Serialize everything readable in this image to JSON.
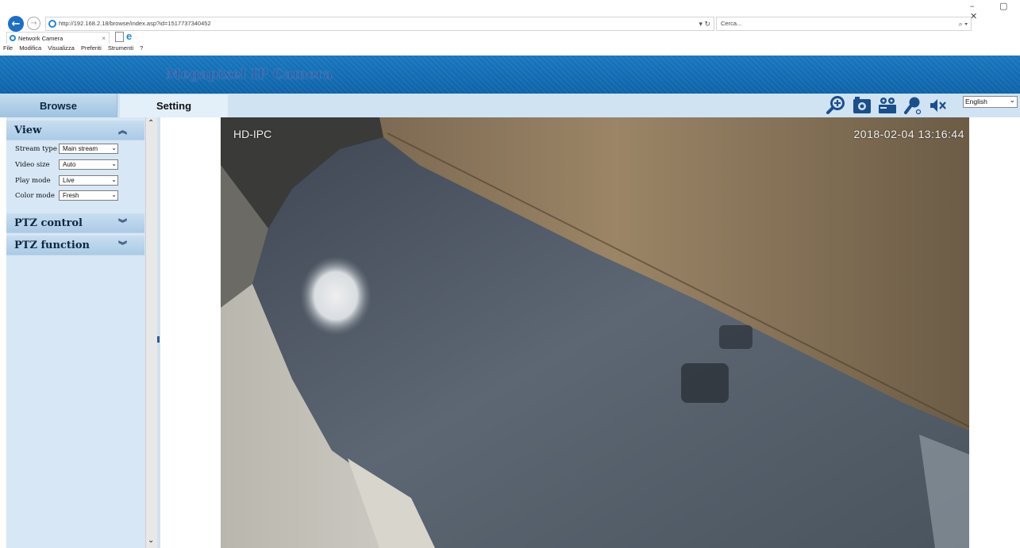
{
  "browser": {
    "url": "http://192.168.2.18/browse/index.asp?id=1517737340452",
    "url_controls": "▾ ↻",
    "search_placeholder": "Cerca...",
    "search_controls": "⌕ ▾",
    "toolbar_icons": "⌂ ☆ ⚙ ☺",
    "window_controls": "– ▢ ✕",
    "tab_title": "Network Camera",
    "menu": [
      "File",
      "Modifica",
      "Visualizza",
      "Preferiti",
      "Strumenti",
      "?"
    ]
  },
  "camera": {
    "banner_title": "Megapixel IP Camera",
    "nav": {
      "browse": "Browse",
      "setting": "Setting"
    },
    "language": "English",
    "tool_icons": [
      "zoom-in-icon",
      "snapshot-icon",
      "record-icon",
      "microphone-icon",
      "mute-speaker-icon"
    ]
  },
  "panel": {
    "view": {
      "title": "View",
      "rows": [
        {
          "label": "Stream type",
          "value": "Main stream"
        },
        {
          "label": "Video size",
          "value": "Auto"
        },
        {
          "label": "Play mode",
          "value": "Live"
        },
        {
          "label": "Color mode",
          "value": "Fresh"
        }
      ]
    },
    "ptz_control": "PTZ control",
    "ptz_function": "PTZ function"
  },
  "video": {
    "osd_name": "HD-IPC",
    "osd_time": "2018-02-04  13:16:44"
  },
  "colors": {
    "banner": "#1877bf",
    "nav_bg": "#cfe3f3",
    "panel_bg": "#d7e7f5",
    "icon_blue": "#1b4f8c"
  }
}
